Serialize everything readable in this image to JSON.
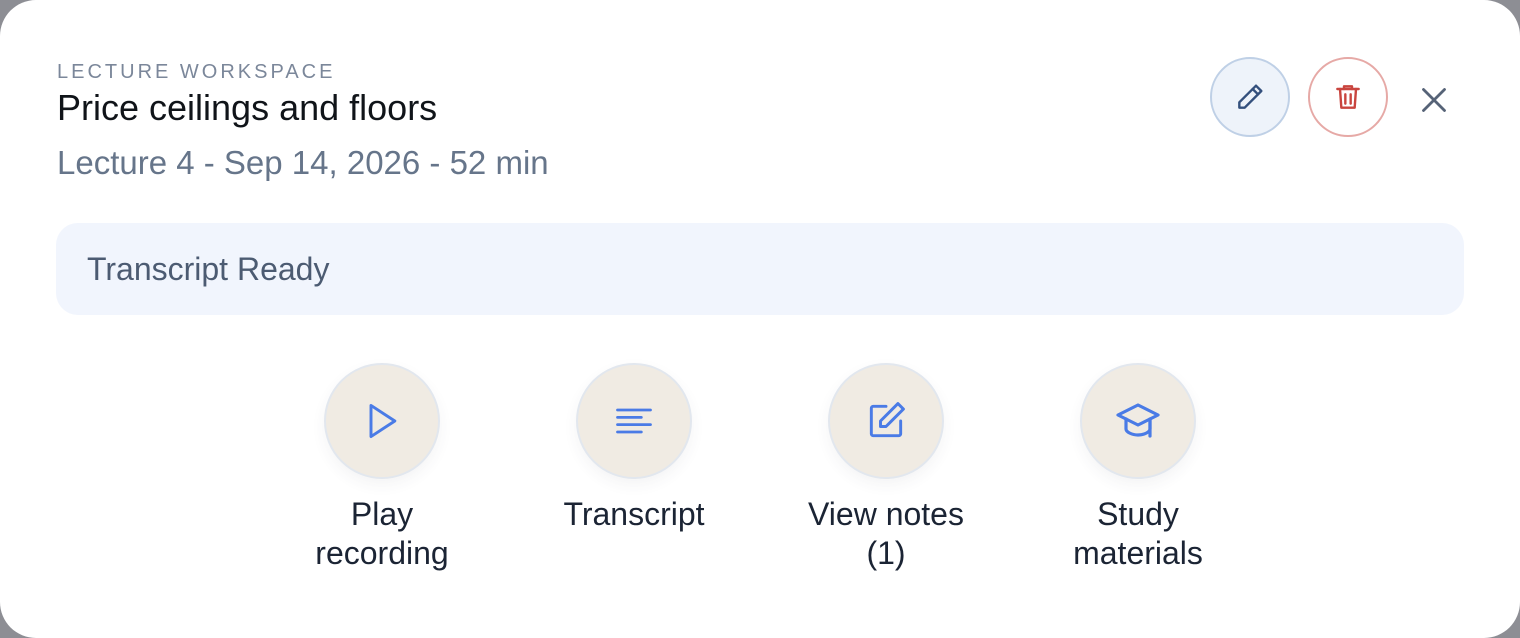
{
  "header": {
    "eyebrow": "LECTURE WORKSPACE",
    "title": "Price ceilings and floors",
    "subtitle": "Lecture 4 - Sep 14, 2026 - 52 min"
  },
  "header_actions": {
    "edit_icon": "pencil-icon",
    "delete_icon": "trash-icon",
    "close_icon": "close-icon"
  },
  "status": {
    "text": "Transcript Ready"
  },
  "actions": [
    {
      "line1": "Play",
      "line2": "recording",
      "icon": "play-icon"
    },
    {
      "line1": "Transcript",
      "line2": "",
      "icon": "text-lines-icon"
    },
    {
      "line1": "View notes",
      "line2": "(1)",
      "icon": "edit-note-icon"
    },
    {
      "line1": "Study",
      "line2": "materials",
      "icon": "graduation-cap-icon"
    }
  ],
  "colors": {
    "accent": "#4a7be6",
    "danger": "#c9453f",
    "action_bg": "#f0ebe3",
    "status_bg": "#f1f5fd"
  }
}
